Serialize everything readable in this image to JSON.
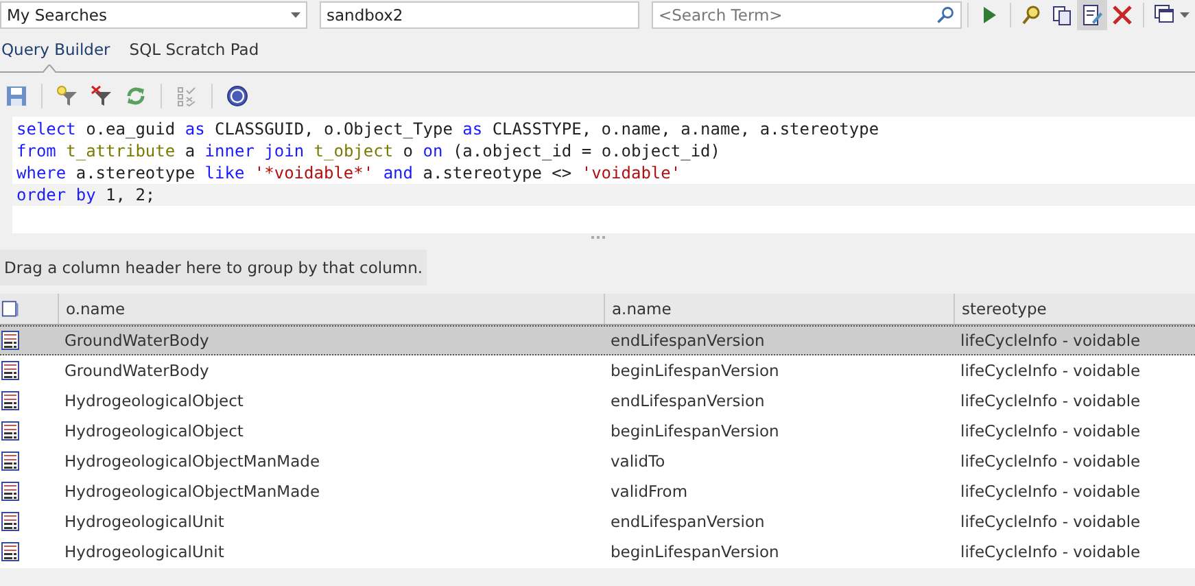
{
  "toolbar": {
    "search_set": "My Searches",
    "search_name": "sandbox2",
    "search_term": {
      "placeholder": "<Search Term>"
    }
  },
  "tabs": [
    {
      "label": "Query Builder",
      "selected": true
    },
    {
      "label": "SQL Scratch Pad",
      "selected": false
    }
  ],
  "editor": {
    "lines": [
      {
        "current": false,
        "tokens": [
          {
            "kind": "keyword",
            "text": "select"
          },
          {
            "kind": "plain",
            "text": " o.ea_guid "
          },
          {
            "kind": "keyword",
            "text": "as"
          },
          {
            "kind": "plain",
            "text": " CLASSGUID, o.Object_Type "
          },
          {
            "kind": "keyword",
            "text": "as"
          },
          {
            "kind": "plain",
            "text": " CLASSTYPE, o.name, a.name, a.stereotype"
          }
        ]
      },
      {
        "current": false,
        "tokens": [
          {
            "kind": "keyword",
            "text": "from"
          },
          {
            "kind": "table",
            "text": " t_attribute"
          },
          {
            "kind": "plain",
            "text": " a "
          },
          {
            "kind": "keyword",
            "text": "inner join"
          },
          {
            "kind": "table",
            "text": " t_object"
          },
          {
            "kind": "plain",
            "text": " o "
          },
          {
            "kind": "keyword",
            "text": "on"
          },
          {
            "kind": "plain",
            "text": " (a.object_id = o.object_id)"
          }
        ]
      },
      {
        "current": false,
        "tokens": [
          {
            "kind": "keyword",
            "text": "where"
          },
          {
            "kind": "plain",
            "text": " a.stereotype "
          },
          {
            "kind": "keyword",
            "text": "like"
          },
          {
            "kind": "string",
            "text": " '*voidable*'"
          },
          {
            "kind": "keyword",
            "text": " and"
          },
          {
            "kind": "plain",
            "text": " a.stereotype <> "
          },
          {
            "kind": "string",
            "text": "'voidable'"
          }
        ]
      },
      {
        "current": true,
        "tokens": [
          {
            "kind": "keyword",
            "text": "order by"
          },
          {
            "kind": "plain",
            "text": " 1, 2;"
          }
        ]
      }
    ]
  },
  "group_hint": "Drag a column header here to group by that column.",
  "table": {
    "columns": [
      "o.name",
      "a.name",
      "stereotype"
    ],
    "rows": [
      {
        "selected": true,
        "cells": [
          "GroundWaterBody",
          "endLifespanVersion",
          "lifeCycleInfo - voidable"
        ]
      },
      {
        "selected": false,
        "cells": [
          "GroundWaterBody",
          "beginLifespanVersion",
          "lifeCycleInfo - voidable"
        ]
      },
      {
        "selected": false,
        "cells": [
          "HydrogeologicalObject",
          "endLifespanVersion",
          "lifeCycleInfo - voidable"
        ]
      },
      {
        "selected": false,
        "cells": [
          "HydrogeologicalObject",
          "beginLifespanVersion",
          "lifeCycleInfo - voidable"
        ]
      },
      {
        "selected": false,
        "cells": [
          "HydrogeologicalObjectManMade",
          "validTo",
          "lifeCycleInfo - voidable"
        ]
      },
      {
        "selected": false,
        "cells": [
          "HydrogeologicalObjectManMade",
          "validFrom",
          "lifeCycleInfo - voidable"
        ]
      },
      {
        "selected": false,
        "cells": [
          "HydrogeologicalUnit",
          "endLifespanVersion",
          "lifeCycleInfo - voidable"
        ]
      },
      {
        "selected": false,
        "cells": [
          "HydrogeologicalUnit",
          "beginLifespanVersion",
          "lifeCycleInfo - voidable"
        ]
      }
    ]
  }
}
